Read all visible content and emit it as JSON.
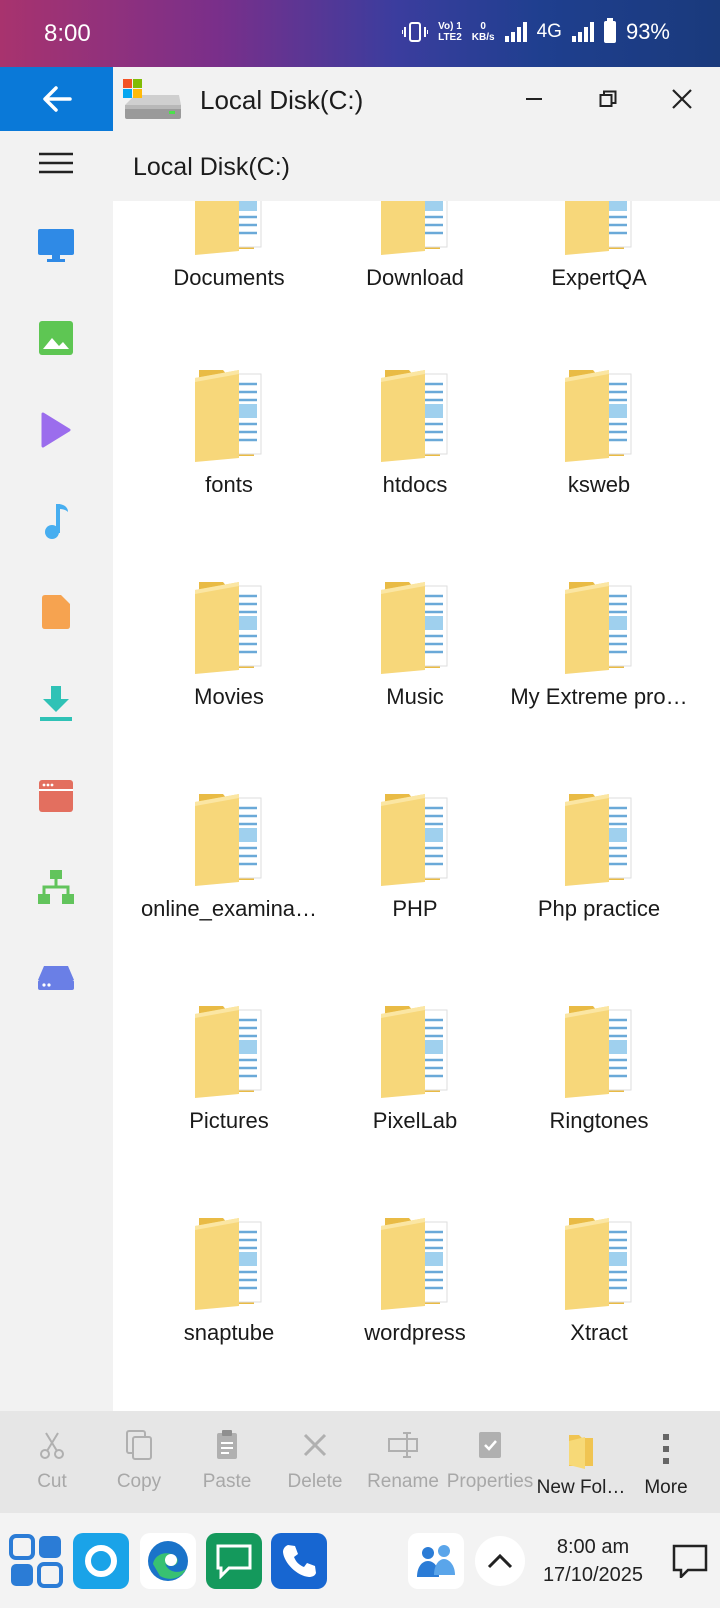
{
  "status_bar": {
    "time": "8:00",
    "volte_top": "Vo) 1",
    "volte_bottom": "LTE2",
    "speed_value": "0",
    "speed_unit": "KB/s",
    "network": "4G",
    "battery": "93%"
  },
  "window": {
    "title": "Local Disk(C:)"
  },
  "path": {
    "text": "Local Disk(C:)"
  },
  "sidebar": {
    "items": [
      {
        "name": "desktop-icon",
        "color": "#2f8ae6"
      },
      {
        "name": "pictures-icon",
        "color": "#5ec653"
      },
      {
        "name": "videos-icon",
        "color": "#9b6ded"
      },
      {
        "name": "music-icon",
        "color": "#47aef0"
      },
      {
        "name": "documents-icon",
        "color": "#f6a350"
      },
      {
        "name": "downloads-icon",
        "color": "#2fc2b6"
      },
      {
        "name": "apps-icon",
        "color": "#e36f5f"
      },
      {
        "name": "network-icon",
        "color": "#62c45c"
      },
      {
        "name": "drive-icon",
        "color": "#6a7fe6"
      }
    ]
  },
  "folders": [
    "Documents",
    "Download",
    "ExpertQA",
    "fonts",
    "htdocs",
    "ksweb",
    "Movies",
    "Music",
    "My Extreme pro…",
    "online_examina…",
    "PHP",
    "Php practice",
    "Pictures",
    "PixelLab",
    "Ringtones",
    "snaptube",
    "wordpress",
    "Xtract"
  ],
  "toolbar": {
    "cut": "Cut",
    "copy": "Copy",
    "paste": "Paste",
    "delete": "Delete",
    "rename": "Rename",
    "properties": "Properties",
    "new_folder": "New Fol…",
    "more": "More"
  },
  "taskbar": {
    "clock_time": "8:00 am",
    "clock_date": "17/10/2025"
  },
  "colors": {
    "accent": "#0a79d8",
    "folder": "#f5cf6b"
  }
}
